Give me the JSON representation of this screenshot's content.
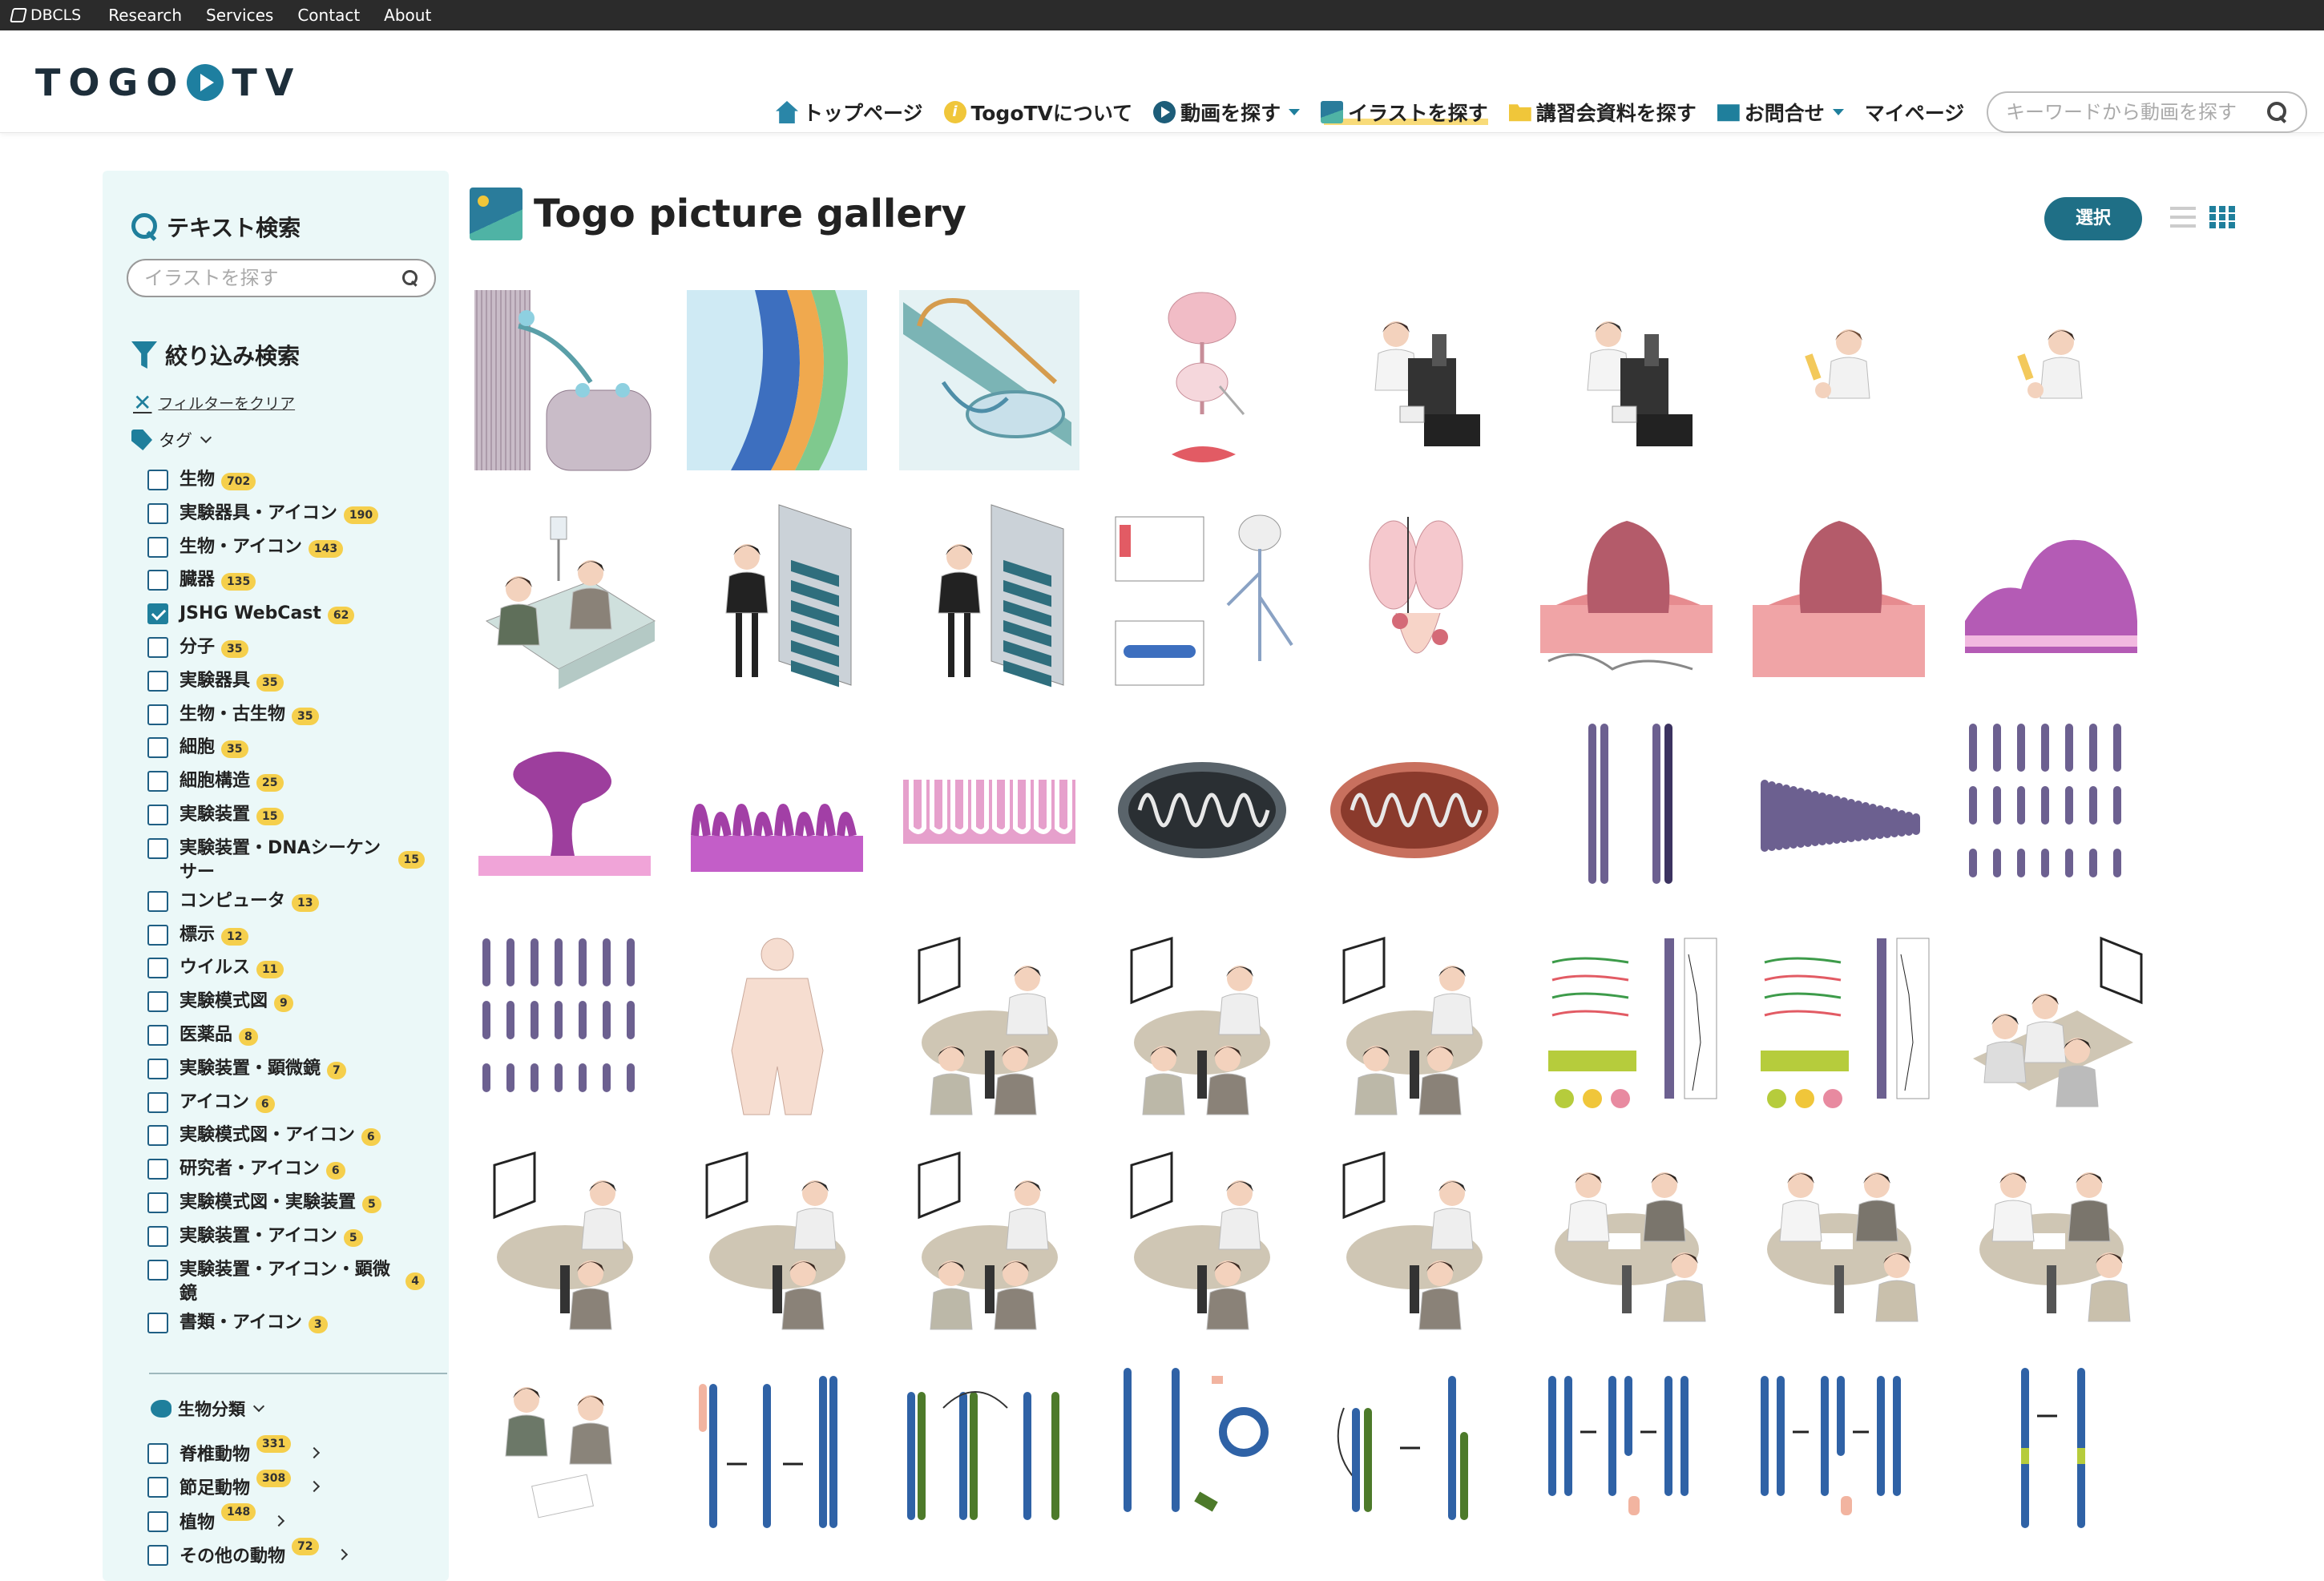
{
  "topbar": {
    "brand": "DBCLS",
    "links": [
      "Research",
      "Services",
      "Contact",
      "About"
    ]
  },
  "header": {
    "logo_left": "TOGO",
    "logo_right": "TV",
    "nav": [
      {
        "label": "トップページ",
        "icon": "home-icon"
      },
      {
        "label": "TogoTVについて",
        "icon": "info-icon"
      },
      {
        "label": "動画を探す",
        "icon": "play-icon",
        "dropdown": true
      },
      {
        "label": "イラストを探す",
        "icon": "picture-icon",
        "active": true
      },
      {
        "label": "講習会資料を探す",
        "icon": "folder-icon"
      },
      {
        "label": "お問合せ",
        "icon": "mail-icon",
        "dropdown": true
      },
      {
        "label": "マイページ",
        "icon": ""
      }
    ],
    "search_placeholder": "キーワードから動画を探す"
  },
  "sidebar": {
    "text_search_title": "テキスト検索",
    "text_search_placeholder": "イラストを探す",
    "filter_title": "絞り込み検索",
    "clear_filter": "フィルターをクリア",
    "tag_title": "タグ",
    "tags": [
      {
        "name": "生物",
        "count": "702",
        "checked": false
      },
      {
        "name": "実験器具・アイコン",
        "count": "190",
        "checked": false
      },
      {
        "name": "生物・アイコン",
        "count": "143",
        "checked": false
      },
      {
        "name": "臓器",
        "count": "135",
        "checked": false
      },
      {
        "name": "JSHG WebCast",
        "count": "62",
        "checked": true
      },
      {
        "name": "分子",
        "count": "35",
        "checked": false
      },
      {
        "name": "実験器具",
        "count": "35",
        "checked": false
      },
      {
        "name": "生物・古生物",
        "count": "35",
        "checked": false
      },
      {
        "name": "細胞",
        "count": "35",
        "checked": false
      },
      {
        "name": "細胞構造",
        "count": "25",
        "checked": false
      },
      {
        "name": "実験装置",
        "count": "15",
        "checked": false
      },
      {
        "name": "実験装置・DNAシーケンサー",
        "count": "15",
        "checked": false
      },
      {
        "name": "コンピュータ",
        "count": "13",
        "checked": false
      },
      {
        "name": "標示",
        "count": "12",
        "checked": false
      },
      {
        "name": "ウイルス",
        "count": "11",
        "checked": false
      },
      {
        "name": "実験模式図",
        "count": "9",
        "checked": false
      },
      {
        "name": "医薬品",
        "count": "8",
        "checked": false
      },
      {
        "name": "実験装置・顕微鏡",
        "count": "7",
        "checked": false
      },
      {
        "name": "アイコン",
        "count": "6",
        "checked": false
      },
      {
        "name": "実験模式図・アイコン",
        "count": "6",
        "checked": false
      },
      {
        "name": "研究者・アイコン",
        "count": "6",
        "checked": false
      },
      {
        "name": "実験模式図・実験装置",
        "count": "5",
        "checked": false
      },
      {
        "name": "実験装置・アイコン",
        "count": "5",
        "checked": false
      },
      {
        "name": "実験装置・アイコン・顕微鏡",
        "count": "4",
        "checked": false
      },
      {
        "name": "書類・アイコン",
        "count": "3",
        "checked": false
      }
    ],
    "bio_title": "生物分類",
    "bio": [
      {
        "name": "脊椎動物",
        "count": "331"
      },
      {
        "name": "節足動物",
        "count": "308"
      },
      {
        "name": "植物",
        "count": "148"
      },
      {
        "name": "その他の動物",
        "count": "72"
      }
    ]
  },
  "gallery": {
    "title": "Togo picture gallery",
    "select_button": "選択",
    "items": [
      {
        "name": "muscle-fiber-illustration",
        "kind": "muscle"
      },
      {
        "name": "epithelium-layers-illustration",
        "kind": "layers"
      },
      {
        "name": "cochlea-illustration",
        "kind": "cochlea"
      },
      {
        "name": "brain-spinal-muscle-illustration",
        "kind": "brainspine"
      },
      {
        "name": "researcher-microscope-woman-illustration",
        "kind": "microscope"
      },
      {
        "name": "researcher-microscope-man-illustration",
        "kind": "microscope2"
      },
      {
        "name": "researcher-tube-woman-illustration",
        "kind": "tube"
      },
      {
        "name": "researcher-tube-man-illustration",
        "kind": "tube2"
      },
      {
        "name": "hospital-bed-illustration",
        "kind": "bed"
      },
      {
        "name": "presenter-woman-board-illustration",
        "kind": "board"
      },
      {
        "name": "presenter-man-board-illustration",
        "kind": "board2"
      },
      {
        "name": "nervous-system-diagram-illustration",
        "kind": "nerve"
      },
      {
        "name": "lungs-organs-illustration",
        "kind": "lungs"
      },
      {
        "name": "tumor-tissue-large-illustration",
        "kind": "tumor"
      },
      {
        "name": "tumor-tissue-small-illustration",
        "kind": "tumor2"
      },
      {
        "name": "purple-tissue-illustration",
        "kind": "purple"
      },
      {
        "name": "polyp-tissue-illustration",
        "kind": "polyp"
      },
      {
        "name": "villi-tissue-illustration",
        "kind": "villi"
      },
      {
        "name": "intestine-wall-illustration",
        "kind": "wall"
      },
      {
        "name": "mitochondria-gray-illustration",
        "kind": "mito-gray"
      },
      {
        "name": "mitochondria-red-illustration",
        "kind": "mito-red"
      },
      {
        "name": "chromosome-pair-illustration",
        "kind": "chromo-pair"
      },
      {
        "name": "karyotype-row-illustration",
        "kind": "karyo-row"
      },
      {
        "name": "karyotype-grid-illustration",
        "kind": "karyo"
      },
      {
        "name": "karyotype-grid-2-illustration",
        "kind": "karyo"
      },
      {
        "name": "body-outline-illustration",
        "kind": "body"
      },
      {
        "name": "meeting-monitor-1-illustration",
        "kind": "meet"
      },
      {
        "name": "meeting-monitor-2-illustration",
        "kind": "meet"
      },
      {
        "name": "meeting-monitor-3-illustration",
        "kind": "meet"
      },
      {
        "name": "genomics-workflow-1-illustration",
        "kind": "workflow"
      },
      {
        "name": "genomics-workflow-2-illustration",
        "kind": "workflow"
      },
      {
        "name": "conference-room-illustration",
        "kind": "conference"
      },
      {
        "name": "video-meeting-1-illustration",
        "kind": "vmeet"
      },
      {
        "name": "video-meeting-2-illustration",
        "kind": "vmeet"
      },
      {
        "name": "video-meeting-3-illustration",
        "kind": "meet"
      },
      {
        "name": "video-meeting-4-illustration",
        "kind": "vmeet"
      },
      {
        "name": "video-meeting-5-illustration",
        "kind": "vmeet"
      },
      {
        "name": "round-table-1-illustration",
        "kind": "table"
      },
      {
        "name": "round-table-2-illustration",
        "kind": "table"
      },
      {
        "name": "round-table-3-illustration",
        "kind": "table"
      },
      {
        "name": "consultation-illustration",
        "kind": "consult"
      },
      {
        "name": "chromosome-translocation-1-illustration",
        "kind": "transloc"
      },
      {
        "name": "chromosome-translocation-2-illustration",
        "kind": "transloc-green"
      },
      {
        "name": "chromosome-ring-illustration",
        "kind": "ring"
      },
      {
        "name": "chromosome-translocation-3-illustration",
        "kind": "transloc-small"
      },
      {
        "name": "chromosome-deletion-1-illustration",
        "kind": "deletion"
      },
      {
        "name": "chromosome-deletion-2-illustration",
        "kind": "deletion"
      },
      {
        "name": "chromosome-inversion-illustration",
        "kind": "inversion"
      }
    ]
  }
}
